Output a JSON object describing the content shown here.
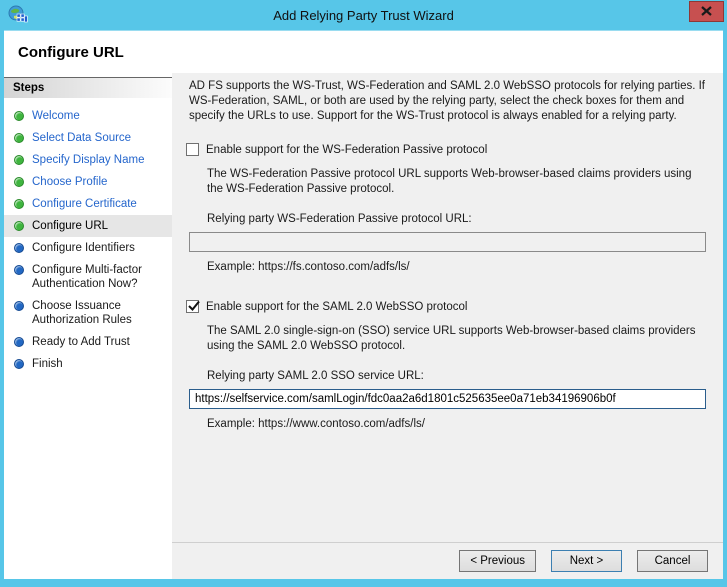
{
  "window": {
    "title": "Add Relying Party Trust Wizard"
  },
  "header": {
    "title": "Configure URL"
  },
  "sidebar": {
    "title": "Steps",
    "items": [
      {
        "label": "Welcome",
        "status": "done"
      },
      {
        "label": "Select Data Source",
        "status": "done"
      },
      {
        "label": "Specify Display Name",
        "status": "done"
      },
      {
        "label": "Choose Profile",
        "status": "done"
      },
      {
        "label": "Configure Certificate",
        "status": "done"
      },
      {
        "label": "Configure URL",
        "status": "current"
      },
      {
        "label": "Configure Identifiers",
        "status": "upcoming"
      },
      {
        "label": "Configure Multi-factor Authentication Now?",
        "status": "upcoming"
      },
      {
        "label": "Choose Issuance Authorization Rules",
        "status": "upcoming"
      },
      {
        "label": "Ready to Add Trust",
        "status": "upcoming"
      },
      {
        "label": "Finish",
        "status": "upcoming"
      }
    ]
  },
  "content": {
    "intro": "AD FS supports the WS-Trust, WS-Federation and SAML 2.0 WebSSO protocols for relying parties.  If WS-Federation, SAML, or both are used by the relying party, select the check boxes for them and specify the URLs to use.  Support for the WS-Trust protocol is always enabled for a relying party.",
    "wsfed": {
      "checkbox_label": "Enable support for the WS-Federation Passive protocol",
      "checked": false,
      "description": "The WS-Federation Passive protocol URL supports Web-browser-based claims providers using the WS-Federation Passive protocol.",
      "url_label": "Relying party WS-Federation Passive protocol URL:",
      "url_value": "",
      "example": "Example: https://fs.contoso.com/adfs/ls/"
    },
    "saml": {
      "checkbox_label": "Enable support for the SAML 2.0 WebSSO protocol",
      "checked": true,
      "description": "The SAML 2.0 single-sign-on (SSO) service URL supports Web-browser-based claims providers using the SAML 2.0 WebSSO protocol.",
      "url_label": "Relying party SAML 2.0 SSO service URL:",
      "url_value": "https://selfservice.com/samlLogin/fdc0aa2a6d1801c525635ee0a71eb34196906b0f",
      "example": "Example: https://www.contoso.com/adfs/ls/"
    }
  },
  "footer": {
    "previous_label": "< Previous",
    "next_label": "Next >",
    "cancel_label": "Cancel"
  },
  "icons": {
    "titlebar": "adfs-wizard-icon",
    "close": "close-icon",
    "checkmark": "checkmark-icon",
    "step_done": "green-dot-icon",
    "step_upcoming": "blue-dot-icon"
  },
  "colors": {
    "titlebar_bg": "#57c6e8",
    "close_button_bg": "#c75050",
    "content_bg": "#f0f0f0",
    "step_link_blue": "#2566cc",
    "step_done_dot": "#3fb53f",
    "step_upcoming_dot": "#2268c3",
    "current_step_highlight": "#e6e6e6",
    "focused_input_border": "#2a5d8c",
    "default_button_border": "#3c7fb1"
  }
}
